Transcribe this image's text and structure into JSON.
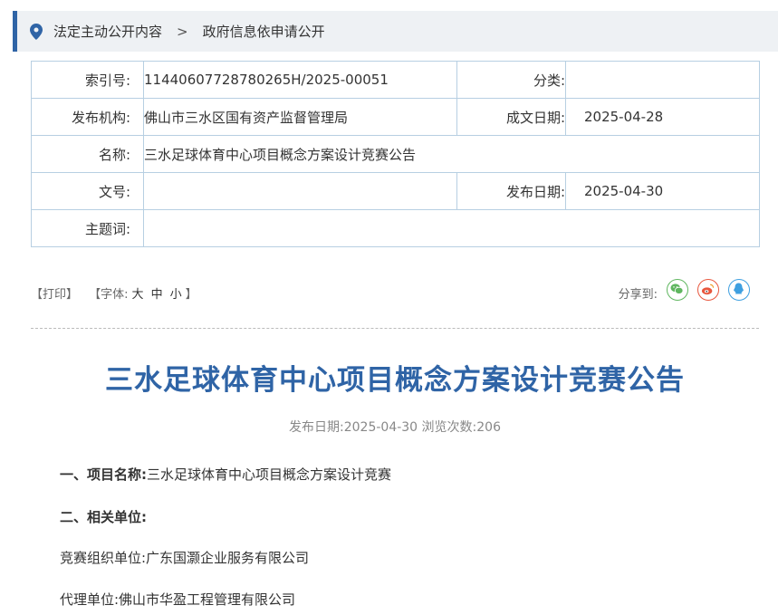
{
  "breadcrumb": {
    "item1": "法定主动公开内容",
    "separator": ">",
    "item2": "政府信息依申请公开"
  },
  "meta": {
    "index_label": "索引号:",
    "index_value": "11440607728780265H/2025-00051",
    "category_label": "分类:",
    "category_value": "",
    "org_label": "发布机构:",
    "org_value": "佛山市三水区国有资产监督管理局",
    "created_label": "成文日期:",
    "created_value": "2025-04-28",
    "name_label": "名称:",
    "name_value": "三水足球体育中心项目概念方案设计竞赛公告",
    "docno_label": "文号:",
    "docno_value": "",
    "published_label": "发布日期:",
    "published_value": "2025-04-30",
    "subject_label": "主题词:",
    "subject_value": ""
  },
  "tools": {
    "print": "【打印】",
    "font_prefix": "【字体:",
    "font_large": "大",
    "font_medium": "中",
    "font_small": "小",
    "font_suffix": "】",
    "share_label": "分享到:",
    "share_icons": [
      "wechat-icon",
      "weibo-icon",
      "qq-icon"
    ],
    "colors": {
      "wechat": "#5fb65f",
      "weibo": "#e8573e",
      "qq": "#3e9fe0"
    }
  },
  "article": {
    "title": "三水足球体育中心项目概念方案设计竞赛公告",
    "stats": "发布日期:2025-04-30  浏览次数:206",
    "sec1_heading": "一、项目名称:",
    "sec1_text": "三水足球体育中心项目概念方案设计竞赛",
    "sec2_heading": "二、相关单位:",
    "organizer": "竞赛组织单位:广东国灏企业服务有限公司",
    "agent": "代理单位:佛山市华盈工程管理有限公司"
  },
  "theme": {
    "accent": "#2f64a6",
    "border": "#b7cfe2"
  }
}
